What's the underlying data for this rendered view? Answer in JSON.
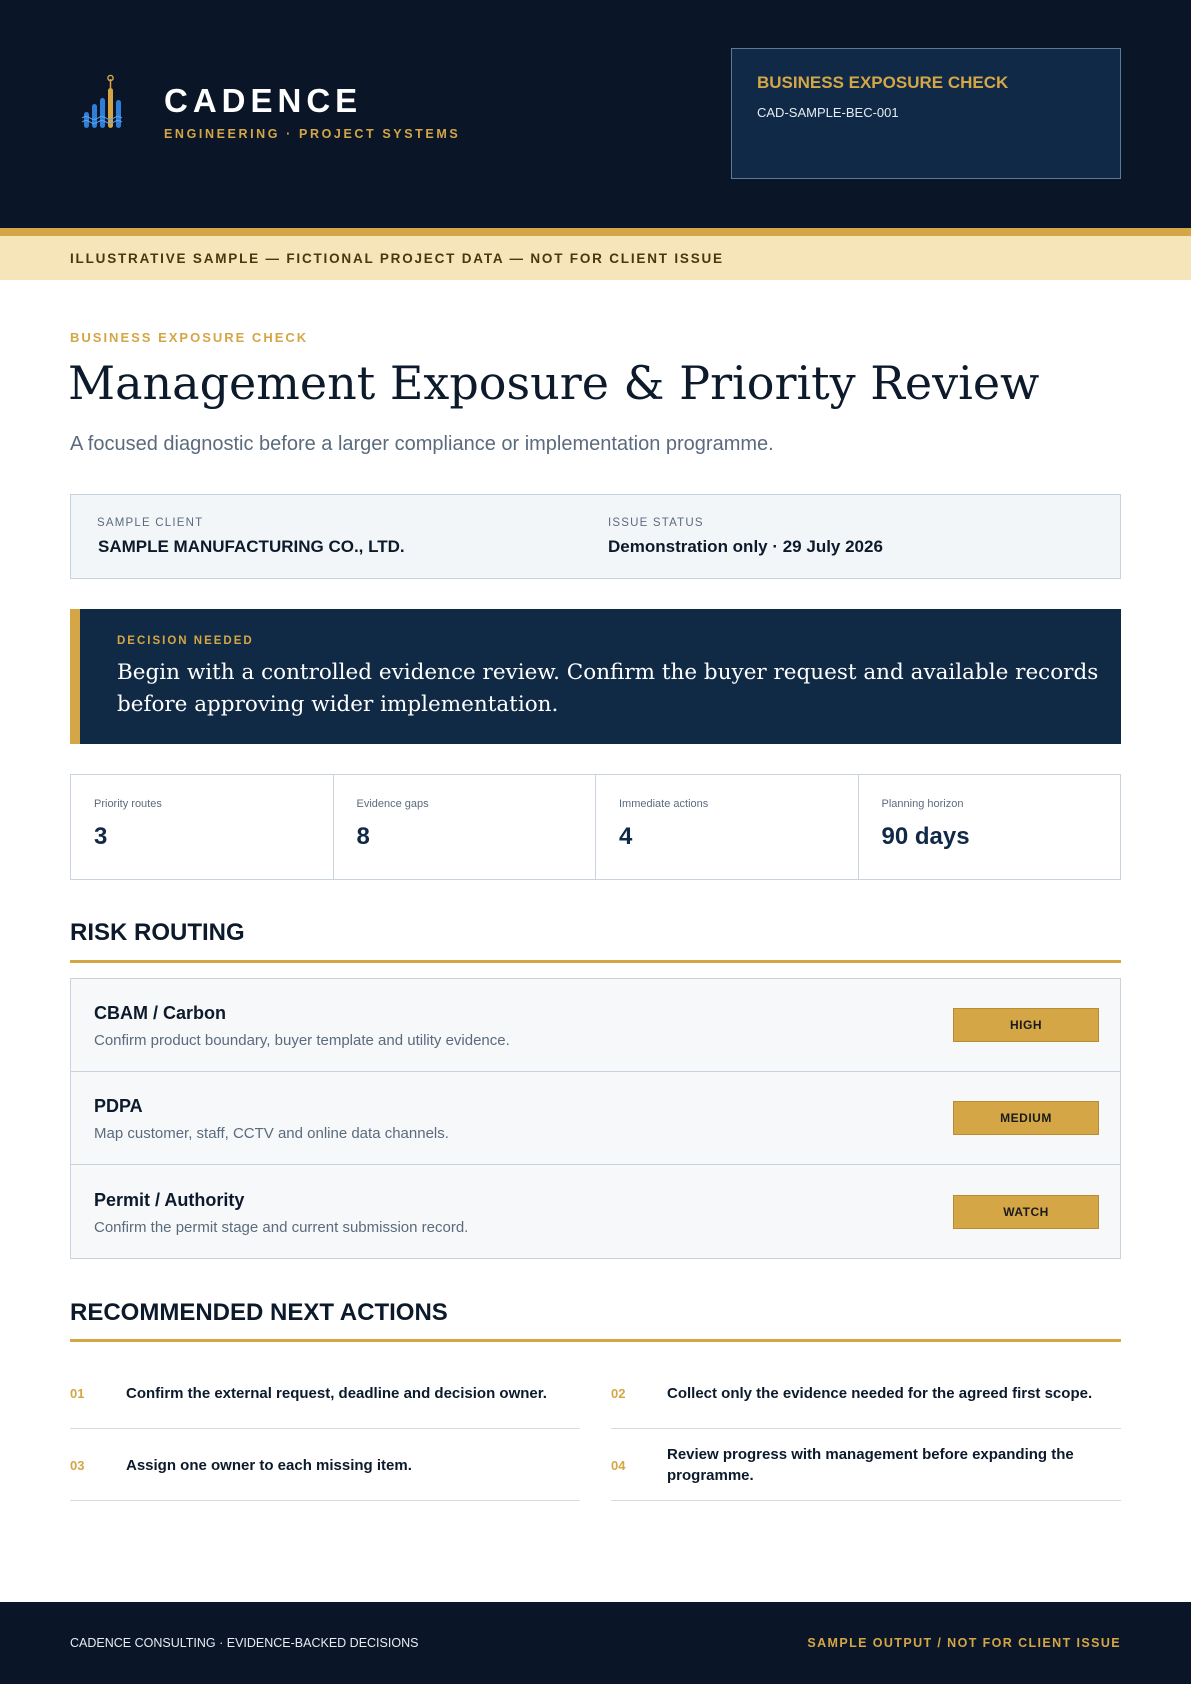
{
  "header": {
    "brand_name": "CADENCE",
    "brand_subtitle": "ENGINEERING · PROJECT SYSTEMS",
    "doc_type": "BUSINESS EXPOSURE CHECK",
    "doc_ref": "CAD-SAMPLE-BEC-001"
  },
  "banner": {
    "text": "ILLUSTRATIVE SAMPLE — FICTIONAL PROJECT DATA — NOT FOR CLIENT ISSUE"
  },
  "intro": {
    "eyebrow": "BUSINESS EXPOSURE CHECK",
    "title": "Management Exposure & Priority Review",
    "lede": "A focused diagnostic before a larger compliance or implementation programme."
  },
  "info": {
    "client_label": "SAMPLE CLIENT",
    "client_value": "SAMPLE MANUFACTURING CO., LTD.",
    "status_label": "ISSUE STATUS",
    "status_value": "Demonstration only · 29 July 2026"
  },
  "decision": {
    "label": "DECISION NEEDED",
    "text": "Begin with a controlled evidence review. Confirm the buyer request and available records before approving wider implementation."
  },
  "metrics": [
    {
      "label": "Priority routes",
      "value": "3"
    },
    {
      "label": "Evidence gaps",
      "value": "8"
    },
    {
      "label": "Immediate actions",
      "value": "4"
    },
    {
      "label": "Planning horizon",
      "value": "90 days"
    }
  ],
  "risk_routing": {
    "title": "RISK ROUTING",
    "items": [
      {
        "name": "CBAM / Carbon",
        "description": "Confirm product boundary, buyer template and utility evidence.",
        "level": "HIGH"
      },
      {
        "name": "PDPA",
        "description": "Map customer, staff, CCTV and online data channels.",
        "level": "MEDIUM"
      },
      {
        "name": "Permit / Authority",
        "description": "Confirm the permit stage and current submission record.",
        "level": "WATCH"
      }
    ]
  },
  "next_actions": {
    "title": "RECOMMENDED NEXT ACTIONS",
    "items": [
      {
        "num": "01",
        "text": "Confirm the external request, deadline and decision owner."
      },
      {
        "num": "02",
        "text": "Collect only the evidence needed for the agreed first scope."
      },
      {
        "num": "03",
        "text": "Assign one owner to each missing item."
      },
      {
        "num": "04",
        "text": "Review progress with management before expanding the programme."
      }
    ]
  },
  "footer": {
    "left": "CADENCE CONSULTING · EVIDENCE-BACKED DECISIONS",
    "right": "SAMPLE OUTPUT / NOT FOR CLIENT ISSUE"
  },
  "colors": {
    "navy": "#0a1628",
    "navy_panel": "#102a45",
    "gold": "#d4a646",
    "cream": "#f5e5b8",
    "logo_blue": "#2f7fd8"
  },
  "icons": {
    "logo": "bar-chart-antenna-icon"
  }
}
